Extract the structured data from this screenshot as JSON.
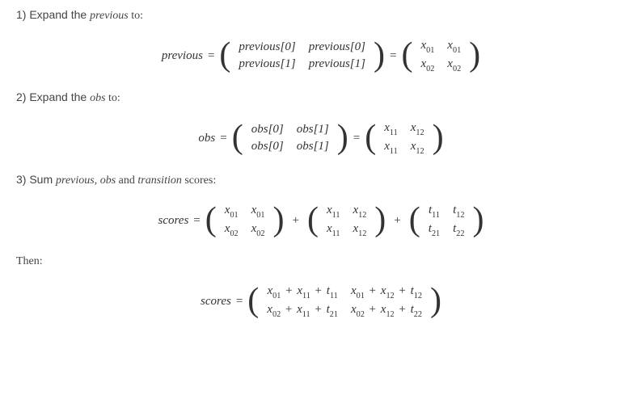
{
  "step1": {
    "label_prefix": "1) Expand the ",
    "label_italic": "previous",
    "label_suffix": " to:",
    "eq": {
      "lhs": "previous",
      "mat1": [
        [
          "previous[0]",
          "previous[0]"
        ],
        [
          "previous[1]",
          "previous[1]"
        ]
      ],
      "mat2": [
        [
          "x",
          "01",
          "x",
          "01"
        ],
        [
          "x",
          "02",
          "x",
          "02"
        ]
      ]
    }
  },
  "step2": {
    "label_prefix": "2) Expand the ",
    "label_italic": "obs",
    "label_suffix": " to:",
    "eq": {
      "lhs": "obs",
      "mat1": [
        [
          "obs[0]",
          "obs[1]"
        ],
        [
          "obs[0]",
          "obs[1]"
        ]
      ],
      "mat2": [
        [
          "x",
          "11",
          "x",
          "12"
        ],
        [
          "x",
          "11",
          "x",
          "12"
        ]
      ]
    }
  },
  "step3": {
    "label_prefix": "3) Sum ",
    "label_i1": "previous",
    "label_mid1": ", ",
    "label_i2": "obs",
    "label_mid2": " and ",
    "label_i3": "transition",
    "label_suffix": " scores:",
    "eq": {
      "lhs": "scores",
      "matA": [
        [
          "x",
          "01",
          "x",
          "01"
        ],
        [
          "x",
          "02",
          "x",
          "02"
        ]
      ],
      "matB": [
        [
          "x",
          "11",
          "x",
          "12"
        ],
        [
          "x",
          "11",
          "x",
          "12"
        ]
      ],
      "matC": [
        [
          "t",
          "11",
          "t",
          "12"
        ],
        [
          "t",
          "21",
          "t",
          "22"
        ]
      ]
    }
  },
  "then": {
    "label": "Then:",
    "eq": {
      "lhs": "scores",
      "mat": [
        [
          [
            "x",
            "01",
            "x",
            "11",
            "t",
            "11"
          ],
          [
            "x",
            "01",
            "x",
            "12",
            "t",
            "12"
          ]
        ],
        [
          [
            "x",
            "02",
            "x",
            "11",
            "t",
            "21"
          ],
          [
            "x",
            "02",
            "x",
            "12",
            "t",
            "22"
          ]
        ]
      ]
    }
  },
  "ops": {
    "eq": "=",
    "plus": "+"
  },
  "chart_data": {
    "type": "table",
    "description": "Mathematical derivation with four equations",
    "equations": [
      {
        "name": "previous_expansion",
        "lhs": "previous",
        "rhs_symbolic": [
          [
            "previous[0]",
            "previous[0]"
          ],
          [
            "previous[1]",
            "previous[1]"
          ]
        ],
        "rhs_values": [
          [
            "x01",
            "x01"
          ],
          [
            "x02",
            "x02"
          ]
        ]
      },
      {
        "name": "obs_expansion",
        "lhs": "obs",
        "rhs_symbolic": [
          [
            "obs[0]",
            "obs[1]"
          ],
          [
            "obs[0]",
            "obs[1]"
          ]
        ],
        "rhs_values": [
          [
            "x11",
            "x12"
          ],
          [
            "x11",
            "x12"
          ]
        ]
      },
      {
        "name": "scores_sum",
        "lhs": "scores",
        "terms": [
          [
            [
              "x01",
              "x01"
            ],
            [
              "x02",
              "x02"
            ]
          ],
          [
            [
              "x11",
              "x12"
            ],
            [
              "x11",
              "x12"
            ]
          ],
          [
            [
              "t11",
              "t12"
            ],
            [
              "t21",
              "t22"
            ]
          ]
        ],
        "op": "+"
      },
      {
        "name": "scores_result",
        "lhs": "scores",
        "rhs": [
          [
            "x01+x11+t11",
            "x01+x12+t12"
          ],
          [
            "x02+x11+t21",
            "x02+x12+t22"
          ]
        ]
      }
    ]
  }
}
